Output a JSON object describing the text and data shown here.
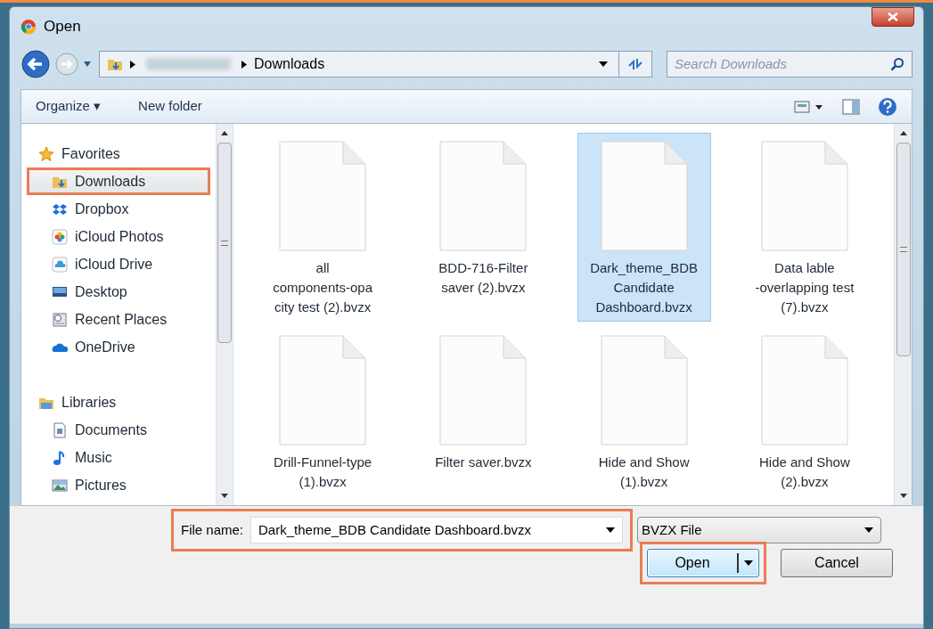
{
  "window": {
    "title": "Open"
  },
  "address": {
    "current": "Downloads",
    "search_placeholder": "Search Downloads"
  },
  "toolbar": {
    "organize": "Organize ▾",
    "new_folder": "New folder"
  },
  "sidebar": [
    {
      "kind": "group",
      "label": "Favorites",
      "selected": false,
      "annotated": false
    },
    {
      "kind": "item",
      "label": "Downloads",
      "selected": true,
      "annotated": true
    },
    {
      "kind": "item",
      "label": "Dropbox",
      "selected": false,
      "annotated": false
    },
    {
      "kind": "item",
      "label": "iCloud Photos",
      "selected": false,
      "annotated": false
    },
    {
      "kind": "item",
      "label": "iCloud Drive",
      "selected": false,
      "annotated": false
    },
    {
      "kind": "item",
      "label": "Desktop",
      "selected": false,
      "annotated": false
    },
    {
      "kind": "item",
      "label": "Recent Places",
      "selected": false,
      "annotated": false
    },
    {
      "kind": "item",
      "label": "OneDrive",
      "selected": false,
      "annotated": false
    },
    {
      "kind": "spacer"
    },
    {
      "kind": "group",
      "label": "Libraries",
      "selected": false,
      "annotated": false
    },
    {
      "kind": "item",
      "label": "Documents",
      "selected": false,
      "annotated": false
    },
    {
      "kind": "item",
      "label": "Music",
      "selected": false,
      "annotated": false
    },
    {
      "kind": "item",
      "label": "Pictures",
      "selected": false,
      "annotated": false
    }
  ],
  "files": [
    {
      "lines": [
        "all",
        "components-opa",
        "city test (2).bvzx"
      ],
      "selected": false
    },
    {
      "lines": [
        "BDD-716-Filter",
        "saver (2).bvzx"
      ],
      "selected": false
    },
    {
      "lines": [
        "Dark_theme_BDB",
        "Candidate",
        "Dashboard.bvzx"
      ],
      "selected": true
    },
    {
      "lines": [
        "Data lable",
        "-overlapping test",
        "(7).bvzx"
      ],
      "selected": false
    },
    {
      "lines": [
        "Drill-Funnel-type",
        "(1).bvzx"
      ],
      "selected": false
    },
    {
      "lines": [
        "Filter saver.bvzx"
      ],
      "selected": false
    },
    {
      "lines": [
        "Hide and Show",
        "(1).bvzx"
      ],
      "selected": false
    },
    {
      "lines": [
        "Hide and Show",
        "(2).bvzx"
      ],
      "selected": false
    }
  ],
  "file_name": {
    "label": "File name:",
    "value": "Dark_theme_BDB Candidate Dashboard.bvzx",
    "annotated": true
  },
  "file_type": "BVZX File",
  "buttons": [
    {
      "label": "Open",
      "kind": "split",
      "annotated": true
    },
    {
      "label": "Cancel",
      "kind": "plain",
      "annotated": false
    }
  ]
}
